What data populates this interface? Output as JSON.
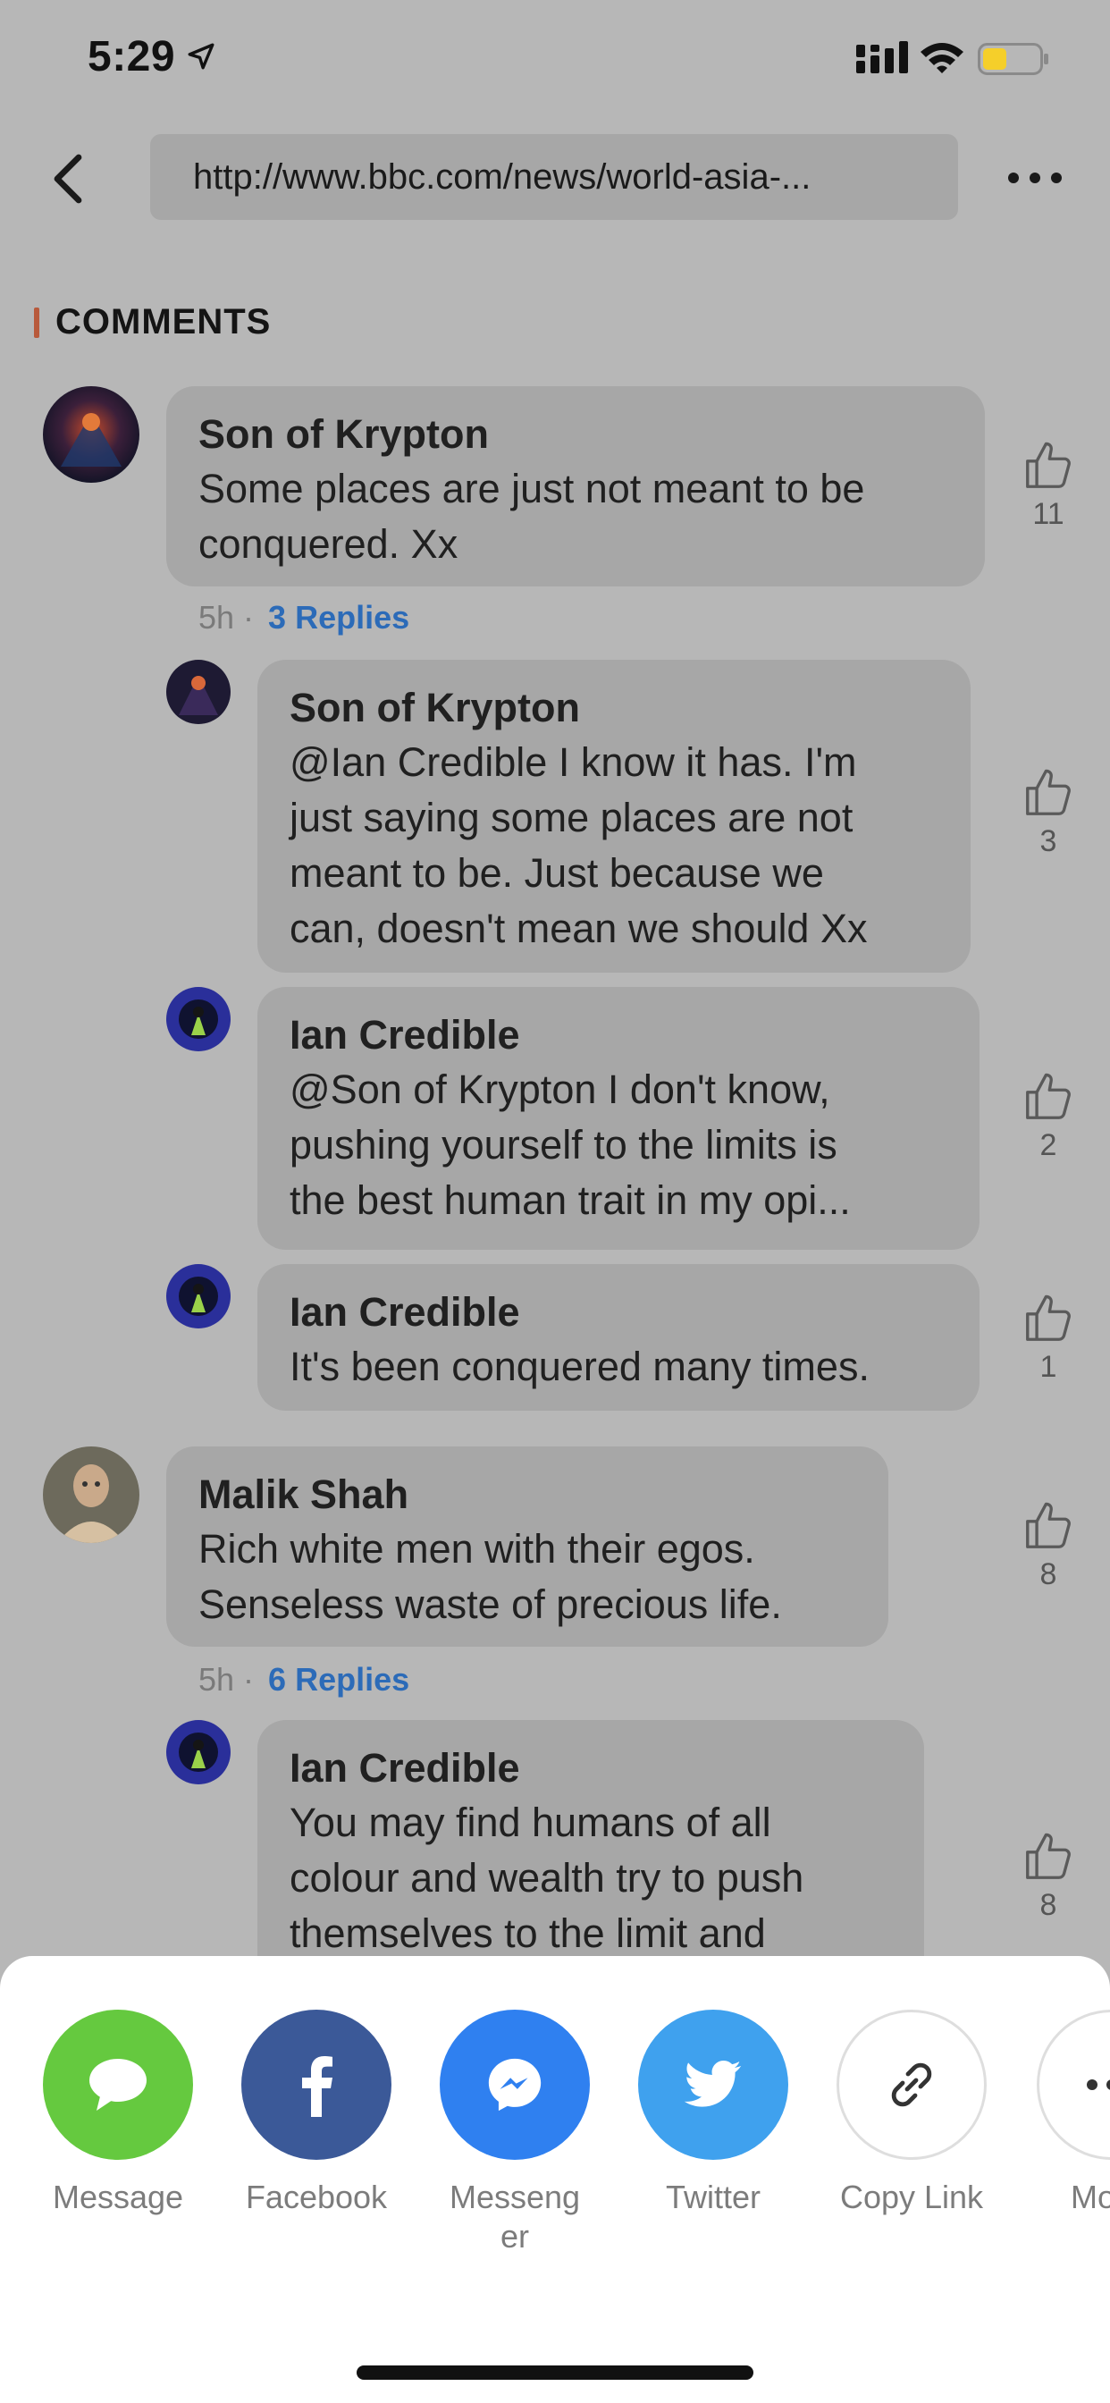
{
  "status": {
    "time": "5:29"
  },
  "nav": {
    "url": "http://www.bbc.com/news/world-asia-..."
  },
  "section": {
    "title": "COMMENTS"
  },
  "comments": [
    {
      "author": "Son of Krypton",
      "text_lines": [
        "Some places are just not meant to be",
        "conquered. Xx"
      ],
      "age": "5h",
      "replies_label": "3 Replies",
      "likes": "11",
      "replies": [
        {
          "author": "Son of Krypton",
          "text_lines": [
            "@Ian Credible I know it has. I'm",
            "just saying some places are not",
            "meant to be. Just because we",
            "can, doesn't mean we should Xx"
          ],
          "likes": "3"
        },
        {
          "author": "Ian Credible",
          "text_lines": [
            "@Son of Krypton I don't know,",
            "pushing yourself to the limits is",
            "the best human trait in my opi..."
          ],
          "likes": "2"
        },
        {
          "author": "Ian Credible",
          "text_lines": [
            "It's been conquered many times."
          ],
          "likes": "1"
        }
      ]
    },
    {
      "author": "Malik Shah",
      "text_lines": [
        "Rich white men with their egos.",
        "Senseless waste of precious life."
      ],
      "age": "5h",
      "replies_label": "6 Replies",
      "likes": "8",
      "replies": [
        {
          "author": "Ian Credible",
          "text_lines": [
            "You may find humans of all",
            "colour and wealth try to push",
            "themselves to the limit and"
          ],
          "likes": "8"
        }
      ]
    }
  ],
  "share": {
    "items": [
      {
        "label": "Message",
        "label_line2": "",
        "color": "#65c93f",
        "icon": "message-icon"
      },
      {
        "label": "Facebook",
        "label_line2": "",
        "color": "#3b5998",
        "icon": "facebook-icon"
      },
      {
        "label": "Messeng",
        "label_line2": "er",
        "color": "#2f80f0",
        "icon": "messenger-icon"
      },
      {
        "label": "Twitter",
        "label_line2": "",
        "color": "#3fa1ee",
        "icon": "twitter-icon"
      },
      {
        "label": "Copy Link",
        "label_line2": "",
        "color": "#ffffff",
        "icon": "link-icon"
      },
      {
        "label": "Mo",
        "label_line2": "",
        "color": "#ffffff",
        "icon": "more-icon"
      }
    ]
  }
}
